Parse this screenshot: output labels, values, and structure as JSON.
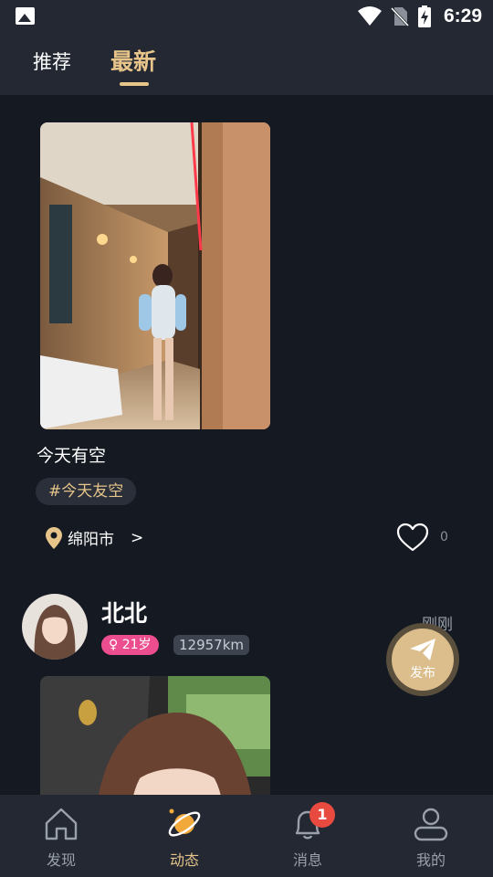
{
  "status_bar": {
    "time": "6:29",
    "icons": [
      "image-icon",
      "wifi-icon",
      "no-sim-icon",
      "battery-charging-icon"
    ]
  },
  "header": {
    "tabs": [
      {
        "label": "推荐",
        "active": false
      },
      {
        "label": "最新",
        "active": true
      }
    ]
  },
  "posts": [
    {
      "text": "今天有空",
      "topic": "#今天友空",
      "location": "绵阳市",
      "location_arrow": ">",
      "like_count": "0"
    },
    {
      "username": "北北",
      "gender_age": "♀ 21岁",
      "distance": "12957km",
      "time": "刚刚"
    }
  ],
  "fab": {
    "label": "发布"
  },
  "bottom_nav": [
    {
      "label": "发现",
      "icon": "home-icon",
      "active": false
    },
    {
      "label": "动态",
      "icon": "planet-icon",
      "active": true
    },
    {
      "label": "消息",
      "icon": "bell-icon",
      "active": false,
      "badge": "1"
    },
    {
      "label": "我的",
      "icon": "profile-icon",
      "active": false
    }
  ],
  "colors": {
    "accent": "#e6c48a",
    "background": "#151922",
    "bar": "#232833",
    "gender_badge": "#ec4d8e",
    "notification_badge": "#e94a3f"
  }
}
